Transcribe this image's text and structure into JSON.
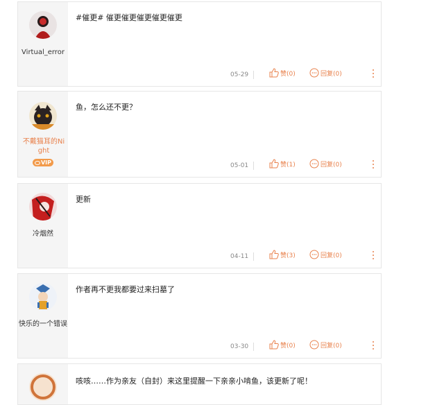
{
  "comments": [
    {
      "username": "Virtual_error",
      "vip": false,
      "text": "#催更# 催更催更催更催更催更",
      "date": "05-29",
      "likes": "赞(0)",
      "replies": "回复(0)",
      "avatar_color": "#b01c1c"
    },
    {
      "username": "不戴猫耳的Night",
      "vip": true,
      "vip_label": "VIP",
      "text": "鱼，怎么还不更？",
      "date": "05-01",
      "likes": "赞(1)",
      "replies": "回复(0)",
      "avatar_color": "#d98a2a"
    },
    {
      "username": "冷烟然",
      "vip": false,
      "text": "更新",
      "date": "04-11",
      "likes": "赞(3)",
      "replies": "回复(0)",
      "avatar_color": "#c41e1e"
    },
    {
      "username": "快乐的一个错误",
      "vip": false,
      "text": "作者再不更我都要过来扫墓了",
      "date": "03-30",
      "likes": "赞(0)",
      "replies": "回复(0)",
      "avatar_color": "#3a6fb0"
    },
    {
      "username": "",
      "vip": false,
      "text": "咳咳……作为亲友（自封）来这里提醒一下亲亲小啃鱼，该更新了呢！",
      "date": "",
      "likes": "",
      "replies": "",
      "avatar_color": "#d0743a"
    }
  ]
}
